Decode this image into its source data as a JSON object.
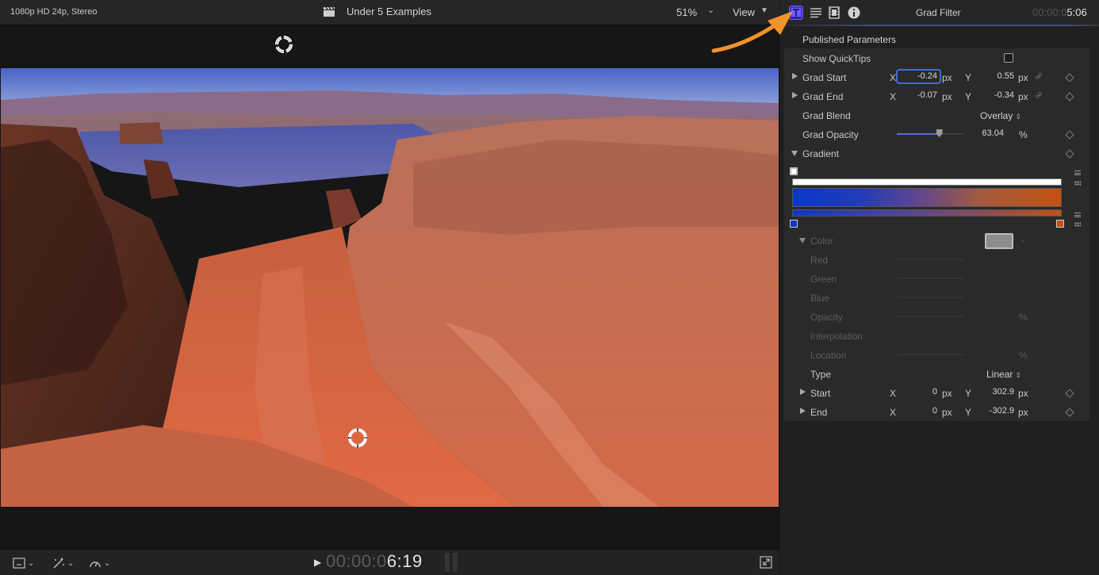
{
  "viewer": {
    "format": "1080p HD 24p, Stereo",
    "project_title": "Under 5 Examples",
    "zoom": "51%",
    "view_label": "View",
    "timecode_dim": "00:00:0",
    "timecode_hi": "6:19"
  },
  "inspector": {
    "title": "Grad Filter",
    "time_dim": "00:00:0",
    "time_hi": "5:06",
    "published_parameters": "Published Parameters",
    "show_quicktips": "Show QuickTips",
    "grad_start": {
      "label": "Grad Start",
      "x_label": "X",
      "x": "-0.24",
      "x_unit": "px",
      "y_label": "Y",
      "y": "0.55",
      "y_unit": "px"
    },
    "grad_end": {
      "label": "Grad End",
      "x_label": "X",
      "x": "-0.07",
      "x_unit": "px",
      "y_label": "Y",
      "y": "-0.34",
      "y_unit": "px"
    },
    "grad_blend": {
      "label": "Grad Blend",
      "value": "Overlay"
    },
    "grad_opacity": {
      "label": "Grad Opacity",
      "value": "63.04",
      "unit": "%",
      "level": 0.63
    },
    "gradient_label": "Gradient",
    "gradient_colors": {
      "start": "#0c37c8",
      "end": "#c15210"
    },
    "color": {
      "label": "Color",
      "swatch": "#8c8c8c"
    },
    "red_label": "Red",
    "green_label": "Green",
    "blue_label": "Blue",
    "opacity": {
      "label": "Opacity",
      "unit": "%"
    },
    "interpolation_label": "Interpolation",
    "location": {
      "label": "Location",
      "unit": "%"
    },
    "type": {
      "label": "Type",
      "value": "Linear"
    },
    "start": {
      "label": "Start",
      "x_label": "X",
      "x": "0",
      "x_unit": "px",
      "y_label": "Y",
      "y": "302.9",
      "y_unit": "px"
    },
    "end": {
      "label": "End",
      "x_label": "X",
      "x": "0",
      "x_unit": "px",
      "y_label": "Y",
      "y": "-302.9",
      "y_unit": "px"
    }
  },
  "icons": [
    "clapper-icon",
    "onscreen-control-icon",
    "transform-icon",
    "enhance-icon",
    "speed-icon",
    "play-icon",
    "fullscreen-icon",
    "title-inspector-icon",
    "text-inspector-icon",
    "video-inspector-icon",
    "info-icon",
    "keyframe-icon",
    "reset-icon"
  ],
  "colors": {
    "accent": "#6a5cff",
    "callout_arrow": "#f2922a",
    "focus": "#3f6fd1"
  }
}
